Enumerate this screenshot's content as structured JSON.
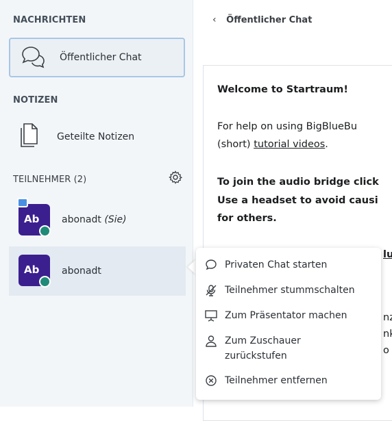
{
  "sidebar": {
    "messages_title": "NACHRICHTEN",
    "public_chat_label": "Öffentlicher Chat",
    "notes_title": "NOTIZEN",
    "shared_notes_label": "Geteilte Notizen",
    "participants_title": "TEILNEHMER (2)",
    "users": [
      {
        "initials": "Ab",
        "name": "abonadt",
        "suffix": "(Sie)"
      },
      {
        "initials": "Ab",
        "name": "abonadt",
        "suffix": ""
      }
    ]
  },
  "main": {
    "back_label": "Öffentlicher Chat",
    "welcome_lines": [
      "Welcome to Startraum!",
      "For help on using BigBlueBu",
      "(short)",
      "tutorial videos",
      ".",
      "To join the audio bridge click",
      "Use a headset to avoid causi",
      "for others."
    ],
    "partial_fragments": [
      "lu",
      "nz",
      "nk",
      "o"
    ]
  },
  "menu": {
    "items": [
      {
        "label": "Privaten Chat starten",
        "icon": "chat-bubble-icon"
      },
      {
        "label": "Teilnehmer stummschalten",
        "icon": "mic-off-icon"
      },
      {
        "label": "Zum Präsentator machen",
        "icon": "presentation-icon"
      },
      {
        "label": "Zum Zuschauer",
        "label2": "zurückstufen",
        "icon": "user-icon"
      },
      {
        "label": "Teilnehmer entfernen",
        "icon": "remove-circle-icon"
      }
    ]
  },
  "colors": {
    "sidebar_bg": "#f3f6f9",
    "avatar": "#3b1f8f",
    "mic_badge": "#1f8a78",
    "selection_border": "#a8c6e6"
  }
}
